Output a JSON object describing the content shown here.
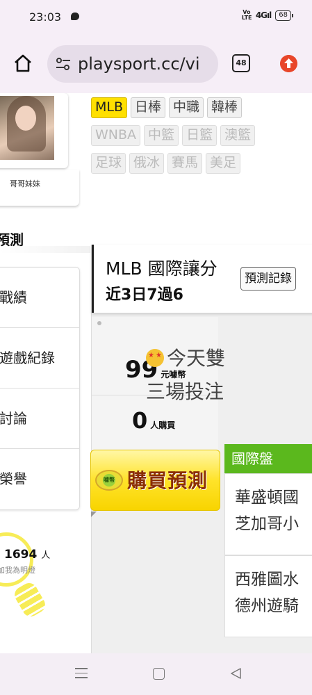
{
  "status_bar": {
    "time": "23:03",
    "network": "4G",
    "battery": "68"
  },
  "browser": {
    "url": "playsport.cc/vi",
    "tab_count": "48"
  },
  "profile": {
    "name": "哥哥妹妹"
  },
  "leagues": {
    "row1": [
      "MLB",
      "日棒",
      "中職",
      "韓棒"
    ],
    "row2": [
      "WNBA",
      "中籃",
      "日籃",
      "澳籃"
    ],
    "row3": [
      "足球",
      "俄冰",
      "賽馬",
      "美足"
    ],
    "active": "MLB"
  },
  "sidebar": {
    "heading": "預測",
    "items": [
      {
        "label": "戰績"
      },
      {
        "label": "遊戲紀錄"
      },
      {
        "label": "討論"
      },
      {
        "label": "榮譽"
      }
    ],
    "lamp": {
      "count": "1694",
      "unit": "人",
      "caption": "加我為明燈"
    }
  },
  "prediction": {
    "title": "MLB 國際讓分",
    "record": "近3日7過6",
    "history_button": "預測記錄",
    "price": "99",
    "price_unit": "元噱幣",
    "buyers": "0",
    "buyers_unit": "人購買",
    "buy_button": "購買預測",
    "buy_badge": "噱幣",
    "intro_line1": "今天雙",
    "intro_line2": "三場投注"
  },
  "market": {
    "label": "國際盤",
    "games": [
      {
        "line1": "華盛頓國",
        "line2": "芝加哥小"
      },
      {
        "line1": "西雅圖水",
        "line2": "德州遊騎"
      }
    ]
  },
  "colors": {
    "active_tag": "#ffe000",
    "market_header": "#5bb81d",
    "buy_button": "#ffe32a",
    "update_badge": "#e8462a"
  }
}
